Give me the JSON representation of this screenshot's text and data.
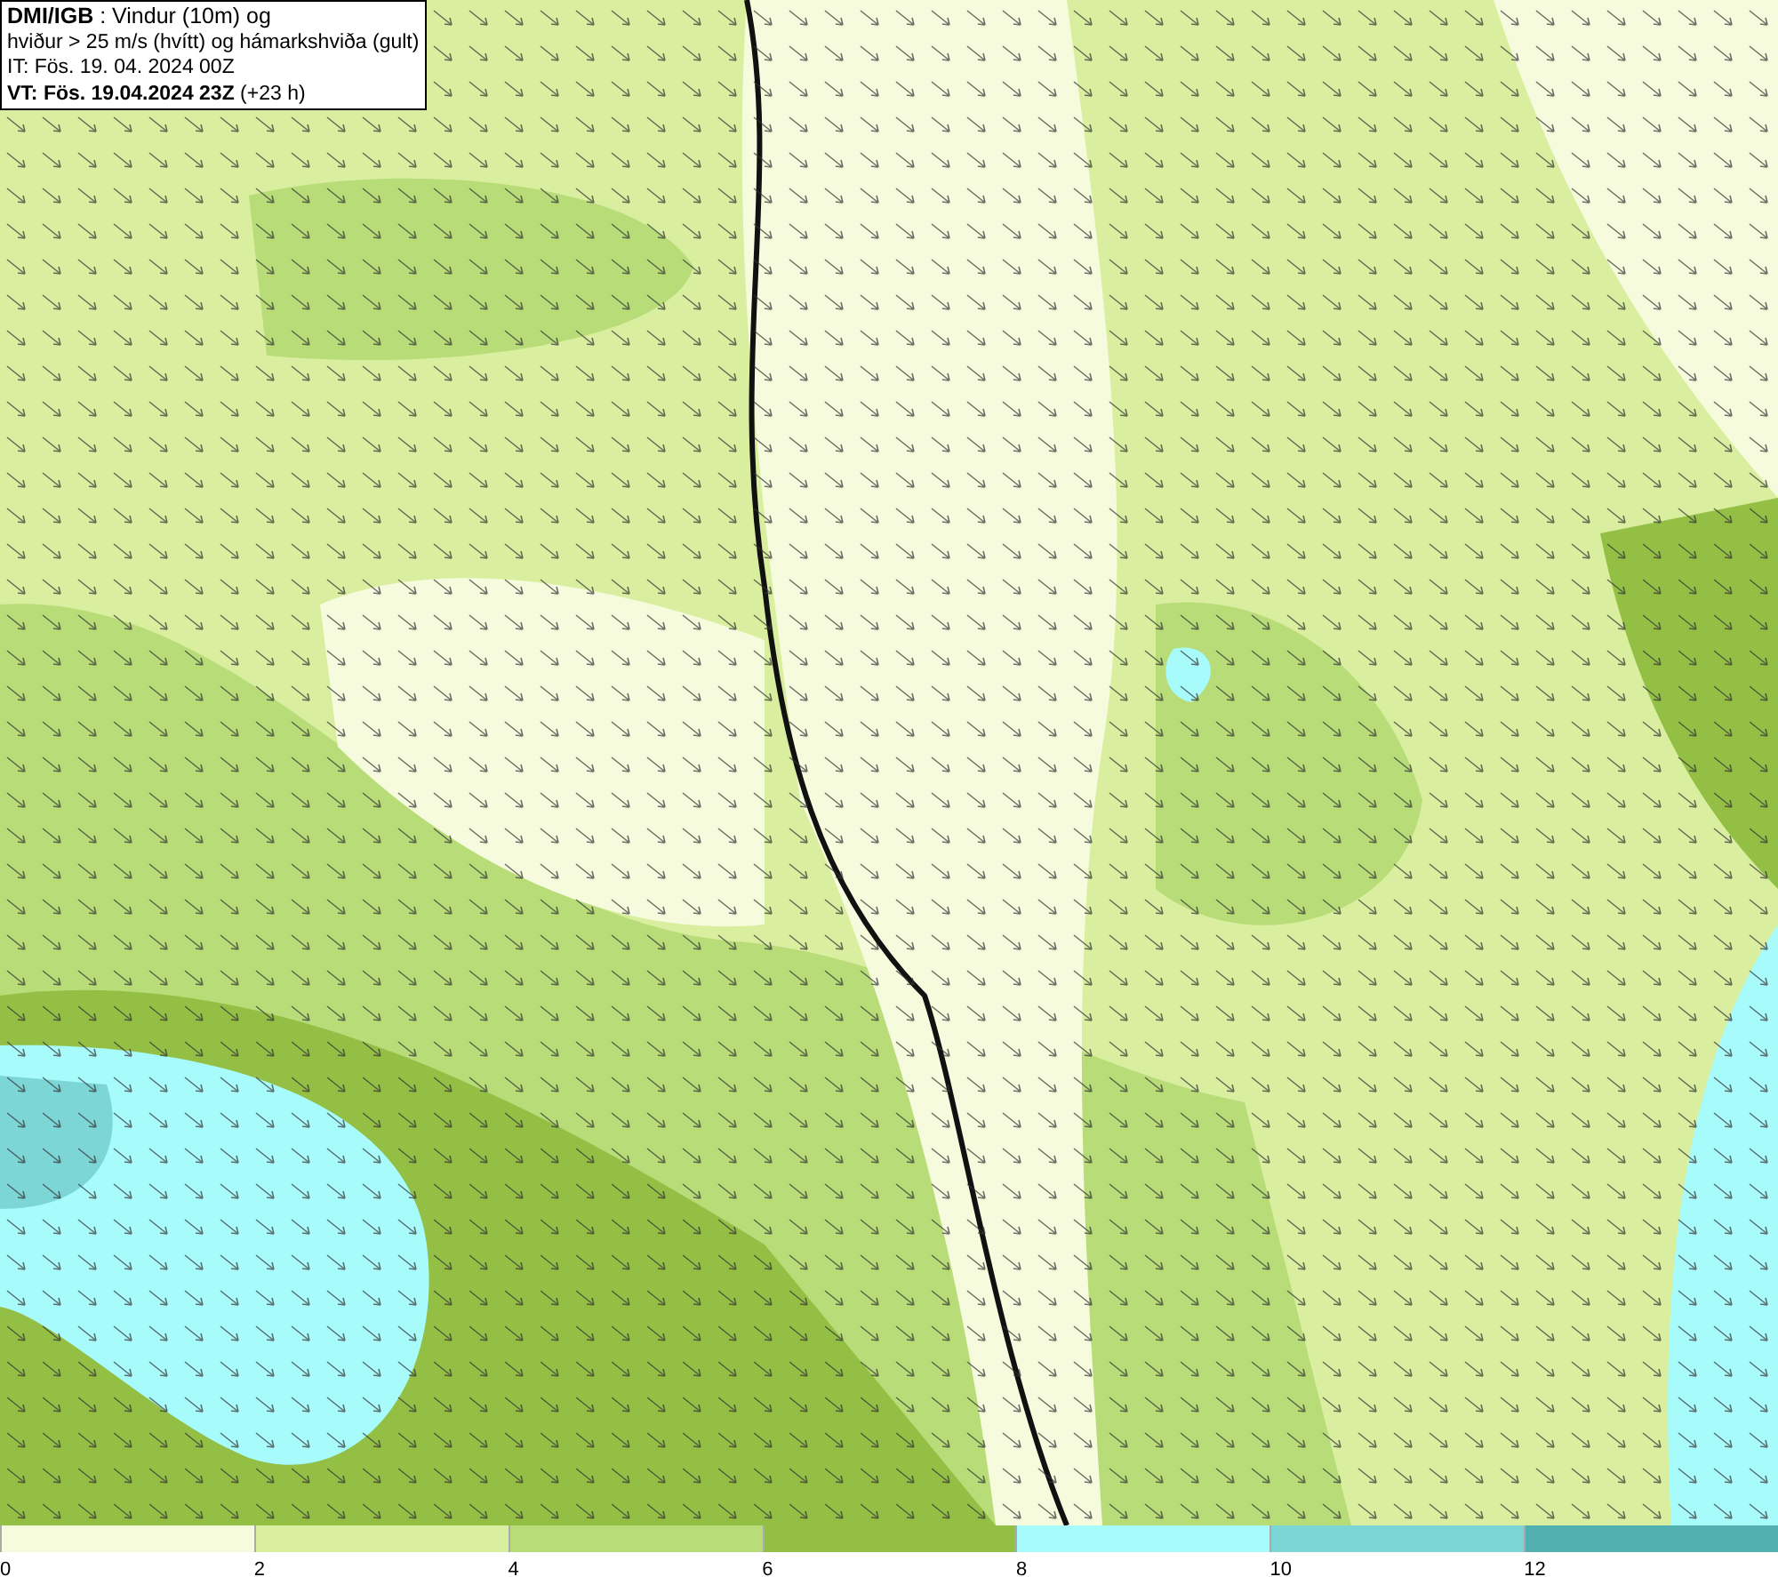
{
  "title_box": {
    "lines": [
      "**DMI/IGB** : Vindur (10m) og",
      "hviður > 25 m/s (hvítt) og hámarkshviða (gult)",
      "IT: Fös. 19. 04. 2024 00Z",
      "**VT: Fös. 19.04.2024 23Z** (+23 h)"
    ]
  },
  "legend": [
    {
      "label": "0",
      "color": "#f5fbdc"
    },
    {
      "label": "2",
      "color": "#d9ef9f"
    },
    {
      "label": "4",
      "color": "#b8dc78"
    },
    {
      "label": "6",
      "color": "#93bf44"
    },
    {
      "label": "8",
      "color": "#a8fbfb"
    },
    {
      "label": "10",
      "color": "#7dd6d6"
    },
    {
      "label": "12",
      "color": "#52b0b0"
    }
  ]
}
